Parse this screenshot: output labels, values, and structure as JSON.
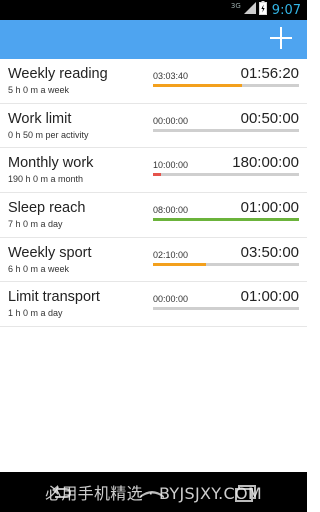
{
  "status_bar": {
    "network_label": "3G",
    "time": "9:07"
  },
  "action_bar": {
    "add_icon": "plus-icon"
  },
  "goals": [
    {
      "title": "Weekly reading",
      "subtitle": "5 h 0 m a week",
      "elapsed": "03:03:40",
      "target": "01:56:20",
      "progress": 0.61,
      "color": "#f3a01c"
    },
    {
      "title": "Work limit",
      "subtitle": "0 h 50 m per activity",
      "elapsed": "00:00:00",
      "target": "00:50:00",
      "progress": 0.0,
      "color": "#f3a01c"
    },
    {
      "title": "Monthly work",
      "subtitle": "190 h 0 m a month",
      "elapsed": "10:00:00",
      "target": "180:00:00",
      "progress": 0.053,
      "color": "#e5534b"
    },
    {
      "title": "Sleep reach",
      "subtitle": "7 h 0 m a day",
      "elapsed": "08:00:00",
      "target": "01:00:00",
      "progress": 1.0,
      "color": "#6bb33b"
    },
    {
      "title": "Weekly sport",
      "subtitle": "6 h 0 m a week",
      "elapsed": "02:10:00",
      "target": "03:50:00",
      "progress": 0.36,
      "color": "#f3a01c"
    },
    {
      "title": "Limit transport",
      "subtitle": "1 h 0 m a day",
      "elapsed": "00:00:00",
      "target": "01:00:00",
      "progress": 0.0,
      "color": "#f3a01c"
    }
  ],
  "navigation": {
    "back_icon": "back-icon",
    "home_icon": "home-icon",
    "recent_icon": "recent-apps-icon"
  },
  "watermark": "必用手机精选 · BYJSJXY.COM"
}
